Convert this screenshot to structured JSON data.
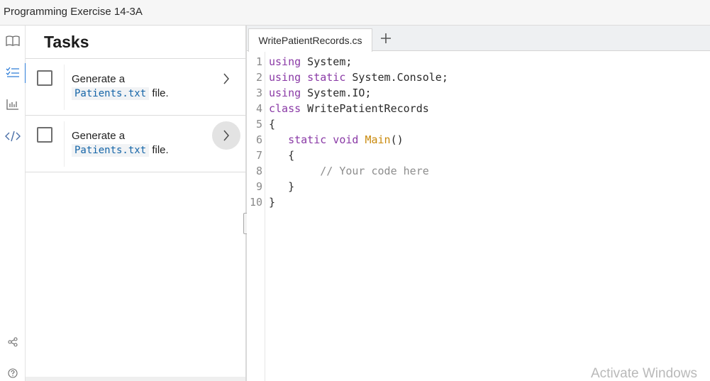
{
  "window": {
    "title": "Programming Exercise 14-3A"
  },
  "rail": {
    "icons": [
      "book-icon",
      "checklist-icon",
      "bar-chart-icon",
      "code-icon",
      "share-icon",
      "help-icon"
    ]
  },
  "tasks": {
    "heading": "Tasks",
    "items": [
      {
        "prefix": "Generate a",
        "filename": "Patients.txt",
        "suffix": "file."
      },
      {
        "prefix": "Generate a",
        "filename": "Patients.txt",
        "suffix": "file."
      }
    ]
  },
  "editor": {
    "tab_label": "WritePatientRecords.cs",
    "add_tab": "+",
    "line_numbers": [
      "1",
      "2",
      "3",
      "4",
      "5",
      "6",
      "7",
      "8",
      "9",
      "10"
    ],
    "lines": {
      "l1": {
        "kw": "using",
        "rest": " System;"
      },
      "l2": {
        "kw": "using static",
        "rest": " System.Console;"
      },
      "l3": {
        "kw": "using",
        "rest": " System.IO;"
      },
      "l4": {
        "kw": "class",
        "rest": " WritePatientRecords"
      },
      "l5": {
        "text": "{"
      },
      "l6": {
        "indent": "   ",
        "kw": "static void",
        "sp": " ",
        "fn": "Main",
        "rest": "()"
      },
      "l7": {
        "text": "   {"
      },
      "l8": {
        "text": "        // Your code here"
      },
      "l9": {
        "text": "   }"
      },
      "l10": {
        "text": "}"
      }
    }
  },
  "watermark": "Activate Windows",
  "colors": {
    "accent": "#2e7dd8",
    "keyword": "#8a3aa6",
    "function": "#c9890b",
    "comment": "#8d8d8d",
    "code_inline": "#1565a8"
  }
}
